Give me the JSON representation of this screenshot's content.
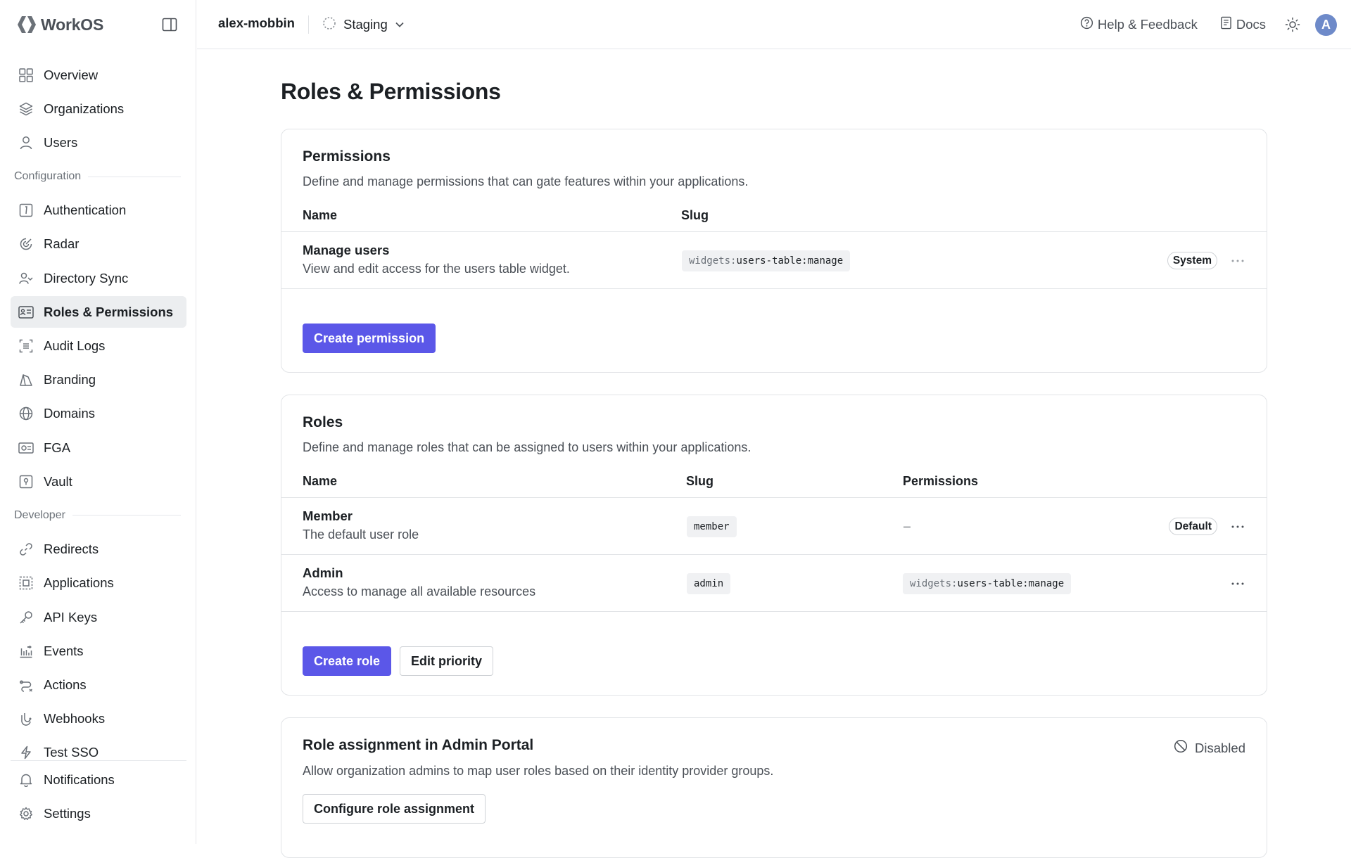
{
  "brand": {
    "name": "WorkOS"
  },
  "sidebar": {
    "items": [
      {
        "label": "Overview",
        "icon": "overview-icon"
      },
      {
        "label": "Organizations",
        "icon": "layers-icon"
      },
      {
        "label": "Users",
        "icon": "user-icon"
      }
    ],
    "config_section": "Configuration",
    "config_items": [
      {
        "label": "Authentication",
        "icon": "authentication-icon"
      },
      {
        "label": "Radar",
        "icon": "radar-icon"
      },
      {
        "label": "Directory Sync",
        "icon": "directory-sync-icon"
      },
      {
        "label": "Roles & Permissions",
        "icon": "roles-permissions-icon",
        "active": true
      },
      {
        "label": "Audit Logs",
        "icon": "audit-logs-icon"
      },
      {
        "label": "Branding",
        "icon": "branding-icon"
      },
      {
        "label": "Domains",
        "icon": "globe-icon"
      },
      {
        "label": "FGA",
        "icon": "fga-icon"
      },
      {
        "label": "Vault",
        "icon": "vault-icon"
      }
    ],
    "developer_section": "Developer",
    "developer_items": [
      {
        "label": "Redirects",
        "icon": "link-icon"
      },
      {
        "label": "Applications",
        "icon": "applications-icon"
      },
      {
        "label": "API Keys",
        "icon": "key-icon"
      },
      {
        "label": "Events",
        "icon": "events-icon"
      },
      {
        "label": "Actions",
        "icon": "actions-icon"
      },
      {
        "label": "Webhooks",
        "icon": "webhooks-icon"
      },
      {
        "label": "Test SSO",
        "icon": "bolt-icon"
      }
    ],
    "bottom_items": [
      {
        "label": "Notifications",
        "icon": "bell-icon"
      },
      {
        "label": "Settings",
        "icon": "gear-icon"
      }
    ]
  },
  "topbar": {
    "team": "alex-mobbin",
    "environment": "Staging",
    "help": "Help & Feedback",
    "docs": "Docs",
    "avatar_initial": "A"
  },
  "page": {
    "title": "Roles & Permissions"
  },
  "permissions": {
    "title": "Permissions",
    "description": "Define and manage permissions that can gate features within your applications.",
    "columns": {
      "name": "Name",
      "slug": "Slug"
    },
    "rows": [
      {
        "name": "Manage users",
        "description": "View and edit access for the users table widget.",
        "slug_prefix": "widgets:",
        "slug_rest": "users-table:manage",
        "badge": "System"
      }
    ],
    "create_button": "Create permission"
  },
  "roles": {
    "title": "Roles",
    "description": "Define and manage roles that can be assigned to users within your applications.",
    "columns": {
      "name": "Name",
      "slug": "Slug",
      "permissions": "Permissions"
    },
    "rows": [
      {
        "name": "Member",
        "description": "The default user role",
        "slug": "member",
        "permissions": "–",
        "badge": "Default"
      },
      {
        "name": "Admin",
        "description": "Access to manage all available resources",
        "slug": "admin",
        "permission_prefix": "widgets:",
        "permission_rest": "users-table:manage"
      }
    ],
    "create_button": "Create role",
    "edit_priority_button": "Edit priority"
  },
  "role_assignment": {
    "title": "Role assignment in Admin Portal",
    "description": "Allow organization admins to map user roles based on their identity provider groups.",
    "status": "Disabled",
    "configure_button": "Configure role assignment"
  },
  "colors": {
    "primary": "#5b57e8",
    "active_nav_bg": "#eceef0",
    "border": "#e2e4e7",
    "avatar": "#6e8ac9"
  }
}
